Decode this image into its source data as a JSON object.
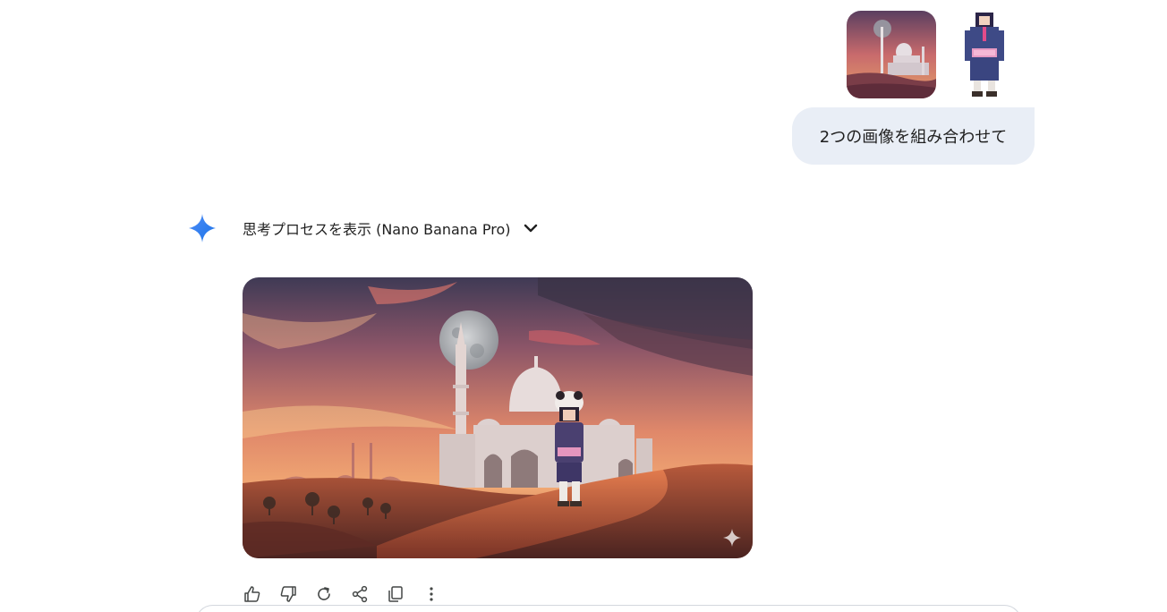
{
  "user_message": {
    "text": "2つの画像を組み合わせて",
    "attachments": [
      {
        "kind": "image",
        "subject": "mosque-at-sunset"
      },
      {
        "kind": "image",
        "subject": "pixel-art-character"
      }
    ]
  },
  "response": {
    "thinking_toggle_label": "思考プロセスを表示 (Nano Banana Pro)",
    "image": {
      "kind": "generated-image",
      "subject": "character-in-desert-before-mosque"
    },
    "actions": [
      "thumbs-up-icon",
      "thumbs-down-icon",
      "regenerate-icon",
      "share-icon",
      "copy-icon",
      "more-options-icon"
    ]
  },
  "colors": {
    "bubble_bg": "#e9eef6",
    "text": "#1f1f1f",
    "icon": "#444746",
    "gemini_blue": "#3b82f6"
  }
}
